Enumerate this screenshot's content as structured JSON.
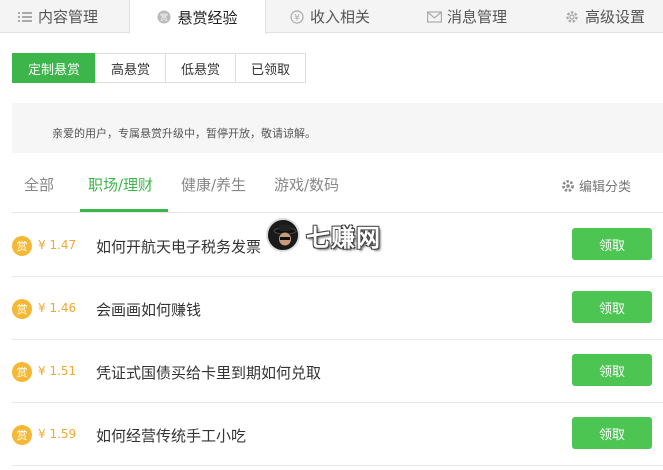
{
  "top_tabs": [
    {
      "label": "内容管理",
      "icon": "list-icon"
    },
    {
      "label": "悬赏经验",
      "icon": "bounty-icon"
    },
    {
      "label": "收入相关",
      "icon": "yen-circle-icon"
    },
    {
      "label": "消息管理",
      "icon": "envelope-icon"
    },
    {
      "label": "高级设置",
      "icon": "gear-icon"
    }
  ],
  "active_top_tab": "悬赏经验",
  "sub_tabs": [
    "定制悬赏",
    "高悬赏",
    "低悬赏",
    "已领取"
  ],
  "active_sub_tab": "定制悬赏",
  "notice": "亲爱的用户，专属悬赏升级中，暂停开放，敬请谅解。",
  "categories": [
    "全部",
    "职场/理财",
    "健康/养生",
    "游戏/数码"
  ],
  "active_category": "职场/理财",
  "edit_category_label": "编辑分类",
  "badge_label": "赏",
  "tasks": [
    {
      "amount": "¥ 1.47",
      "title": "如何开航天电子税务发票",
      "button": "领取"
    },
    {
      "amount": "¥ 1.46",
      "title": "会画画如何赚钱",
      "button": "领取"
    },
    {
      "amount": "¥ 1.51",
      "title": "凭证式国债买给卡里到期如何兑取",
      "button": "领取"
    },
    {
      "amount": "¥ 1.59",
      "title": "如何经营传统手工小吃",
      "button": "领取"
    }
  ],
  "watermark_text": "七赚网",
  "colors": {
    "accent_green": "#3cb64a",
    "button_green": "#4cc553",
    "bounty_gold": "#f0a830"
  }
}
